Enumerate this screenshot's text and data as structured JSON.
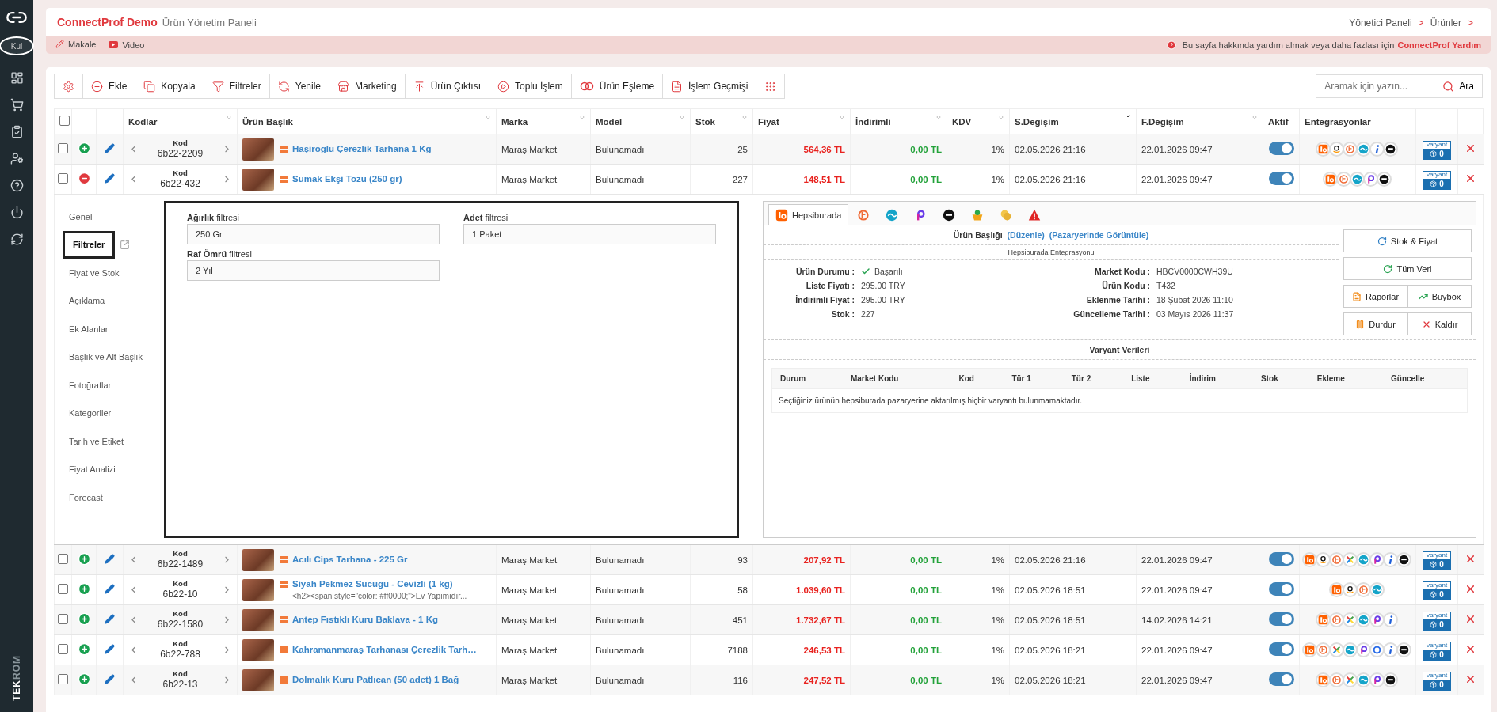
{
  "sidebar": {
    "avatar_text": "Kul",
    "brand": "**TEK**ROM"
  },
  "header": {
    "title": "ConnectProf Demo",
    "subtitle": "Ürün Yönetim Paneli",
    "breadcrumb": [
      {
        "label": "Yönetici Paneli",
        "separator": ">"
      },
      {
        "label": "Ürünler",
        "separator": ">"
      }
    ]
  },
  "help_bar": {
    "links": [
      {
        "kind": "article",
        "label": "Makale"
      },
      {
        "kind": "video",
        "label": "Video"
      }
    ],
    "help_text": "Bu sayfa hakkında yardım almak veya daha fazlası için",
    "help_link": "ConnectProf Yardım"
  },
  "toolbar": {
    "buttons": [
      {
        "kind": "settings"
      },
      {
        "kind": "add",
        "label": "Ekle"
      },
      {
        "kind": "copy",
        "label": "Kopyala"
      },
      {
        "kind": "filter",
        "label": "Filtreler"
      },
      {
        "kind": "refresh",
        "label": "Yenile"
      },
      {
        "kind": "store",
        "label": "Marketing"
      },
      {
        "kind": "export",
        "label": "Ürün Çıktısı"
      },
      {
        "kind": "bulk",
        "label": "Toplu İşlem"
      },
      {
        "kind": "match",
        "label": "Ürün Eşleme"
      },
      {
        "kind": "history",
        "label": "İşlem Geçmişi"
      },
      {
        "kind": "grid"
      }
    ],
    "search": {
      "placeholder": "Aramak için yazın...",
      "button": "Ara"
    }
  },
  "table": {
    "select_all": false,
    "columns": [
      {
        "kind": "check"
      },
      {
        "kind": "blank"
      },
      {
        "kind": "blank"
      },
      {
        "kind": "text",
        "label": "Kodlar",
        "sortable": true,
        "sorted": false
      },
      {
        "kind": "text",
        "label": "Ürün Başlık",
        "sortable": true,
        "sorted": false
      },
      {
        "kind": "text",
        "label": "Marka",
        "sortable": true,
        "sorted": false
      },
      {
        "kind": "text",
        "label": "Model",
        "sortable": true,
        "sorted": false
      },
      {
        "kind": "text",
        "label": "Stok",
        "sortable": true,
        "sorted": false
      },
      {
        "kind": "text",
        "label": "Fiyat",
        "sortable": true,
        "sorted": false
      },
      {
        "kind": "text",
        "label": "İndirimli",
        "sortable": true,
        "sorted": false
      },
      {
        "kind": "text",
        "label": "KDV",
        "sortable": true,
        "sorted": false
      },
      {
        "kind": "text",
        "label": "S.Değişim",
        "sortable": true,
        "sorted": true
      },
      {
        "kind": "text",
        "label": "F.Değişim",
        "sortable": true,
        "sorted": false
      },
      {
        "kind": "text",
        "label": "Aktif"
      },
      {
        "kind": "text",
        "label": "Entegrasyonlar"
      },
      {
        "kind": "blank"
      },
      {
        "kind": "blank"
      }
    ],
    "rows": [
      {
        "checked": false,
        "expanded": false,
        "code_label": "Kod",
        "code": "6b22-2209",
        "title": "Haşiroğlu Çerezlik Tarhana 1 Kg",
        "brand": "Maraş Market",
        "model": "Bulunamadı",
        "stock": "25",
        "price": "564,36 TL",
        "discount_price": "0,00 TL",
        "vat": "1%",
        "s_change": "02.05.2026 21:16",
        "f_change": "22.01.2026 09:47",
        "active": true,
        "integrations": [
          {
            "kind": "hb"
          },
          {
            "kind": "amazon"
          },
          {
            "kind": "t"
          },
          {
            "kind": "wave"
          },
          {
            "kind": "i"
          },
          {
            "kind": "fit"
          }
        ],
        "variant_label": "varyant",
        "variant_count": "0"
      },
      {
        "checked": false,
        "expanded": true,
        "code_label": "Kod",
        "code": "6b22-432",
        "title": "Sumak Ekşi Tozu (250 gr)",
        "brand": "Maraş Market",
        "model": "Bulunamadı",
        "stock": "227",
        "price": "148,51 TL",
        "discount_price": "0,00 TL",
        "vat": "1%",
        "s_change": "02.05.2026 21:16",
        "f_change": "22.01.2026 09:47",
        "active": true,
        "integrations": [
          {
            "kind": "hb"
          },
          {
            "kind": "t"
          },
          {
            "kind": "wave"
          },
          {
            "kind": "p"
          },
          {
            "kind": "fit"
          }
        ],
        "variant_label": "varyant",
        "variant_count": "0",
        "detail": {
          "side_tabs": [
            {
              "label": "Genel",
              "selected": false
            },
            {
              "label": "Filtreler",
              "selected": true
            },
            {
              "label": "Fiyat ve Stok",
              "selected": false
            },
            {
              "label": "Açıklama",
              "selected": false
            },
            {
              "label": "Ek Alanlar",
              "selected": false
            },
            {
              "label": "Başlık ve Alt Başlık",
              "selected": false
            },
            {
              "label": "Fotoğraflar",
              "selected": false
            },
            {
              "label": "Kategoriler",
              "selected": false
            },
            {
              "label": "Tarih ve Etiket",
              "selected": false
            },
            {
              "label": "Fiyat Analizi",
              "selected": false
            },
            {
              "label": "Forecast",
              "selected": false
            }
          ],
          "filters": [
            {
              "label": "**Ağırlık** filtresi",
              "value": "250 Gr"
            },
            {
              "label": "**Adet** filtresi",
              "value": "1 Paket"
            },
            {
              "label": "**Raf Ömrü** filtresi",
              "value": "2 Yıl"
            }
          ],
          "market": {
            "tabs": [
              {
                "kind": "hb",
                "label": "Hepsiburada",
                "selected": true
              },
              {
                "kind": "t",
                "selected": false
              },
              {
                "kind": "wave",
                "selected": false
              },
              {
                "kind": "p",
                "selected": false
              },
              {
                "kind": "fit",
                "selected": false
              },
              {
                "kind": "basket",
                "selected": false
              },
              {
                "kind": "coins",
                "selected": false
              },
              {
                "kind": "warning",
                "selected": false
              }
            ],
            "title_label": "Ürün Başlığı",
            "edit_link": "(Düzenle)",
            "view_link": "(Pazaryerinde Görüntüle)",
            "section": "Hepsiburada Entegrasyonu",
            "left_fields": [
              {
                "kind": "status",
                "label": "Ürün Durumu :",
                "value": "Başarılı"
              },
              {
                "kind": "plain",
                "label": "Liste Fiyatı :",
                "value": "295.00 TRY"
              },
              {
                "kind": "plain",
                "label": "İndirimli Fiyat :",
                "value": "295.00 TRY"
              },
              {
                "kind": "plain",
                "label": "Stok :",
                "value": "227"
              }
            ],
            "right_fields": [
              {
                "label": "Market Kodu :",
                "value": "HBCV0000CWH39U"
              },
              {
                "label": "Ürün Kodu :",
                "value": "T432"
              },
              {
                "label": "Eklenme Tarihi :",
                "value": "18 Şubat 2026 11:10"
              },
              {
                "label": "Güncelleme Tarihi :",
                "value": "03 Mayıs 2026 11:37"
              }
            ],
            "actions": [
              {
                "kind": "sync",
                "label": "Stok & Fiyat",
                "wide": true
              },
              {
                "kind": "reload",
                "label": "Tüm Veri",
                "wide": true
              },
              {
                "kind": "report",
                "label": "Raporlar",
                "wide": false
              },
              {
                "kind": "buybox",
                "label": "Buybox",
                "wide": false
              },
              {
                "kind": "pause",
                "label": "Durdur",
                "wide": false
              },
              {
                "kind": "remove",
                "label": "Kaldır",
                "wide": false
              }
            ],
            "variants": {
              "title": "Varyant Verileri",
              "columns": [
                "Durum",
                "Market Kodu",
                "Kod",
                "Tür 1",
                "Tür 2",
                "Liste",
                "İndirim",
                "Stok",
                "Ekleme",
                "Güncelle"
              ],
              "empty": "Seçtiğiniz ürünün hepsiburada pazaryerine aktarılmış hiçbir varyantı bulunmamaktadır."
            }
          }
        }
      },
      {
        "checked": false,
        "expanded": false,
        "code_label": "Kod",
        "code": "6b22-1489",
        "title": "Acılı Cips Tarhana - 225 Gr",
        "brand": "Maraş Market",
        "model": "Bulunamadı",
        "stock": "93",
        "price": "207,92 TL",
        "discount_price": "0,00 TL",
        "vat": "1%",
        "s_change": "02.05.2026 21:16",
        "f_change": "22.01.2026 09:47",
        "active": true,
        "integrations": [
          {
            "kind": "hb"
          },
          {
            "kind": "amazon"
          },
          {
            "kind": "t"
          },
          {
            "kind": "x"
          },
          {
            "kind": "wave"
          },
          {
            "kind": "p"
          },
          {
            "kind": "i"
          },
          {
            "kind": "fit"
          }
        ],
        "variant_label": "varyant",
        "variant_count": "0"
      },
      {
        "checked": false,
        "expanded": false,
        "code_label": "Kod",
        "code": "6b22-10",
        "title": "Siyah Pekmez Sucuğu - Cevizli (1 kg)",
        "subtitle": "<h2><span style=\"color: #ff0000;\">Ev Yapımıdır...",
        "brand": "Maraş Market",
        "model": "Bulunamadı",
        "stock": "58",
        "price": "1.039,60 TL",
        "discount_price": "0,00 TL",
        "vat": "1%",
        "s_change": "02.05.2026 18:51",
        "f_change": "22.01.2026 09:47",
        "active": true,
        "integrations": [
          {
            "kind": "hb"
          },
          {
            "kind": "amazon"
          },
          {
            "kind": "t"
          },
          {
            "kind": "wave"
          }
        ],
        "variant_label": "varyant",
        "variant_count": "0"
      },
      {
        "checked": false,
        "expanded": false,
        "code_label": "Kod",
        "code": "6b22-1580",
        "title": "Antep Fıstıklı Kuru Baklava - 1 Kg",
        "brand": "Maraş Market",
        "model": "Bulunamadı",
        "stock": "451",
        "price": "1.732,67 TL",
        "discount_price": "0,00 TL",
        "vat": "1%",
        "s_change": "02.05.2026 18:51",
        "f_change": "14.02.2026 14:21",
        "active": true,
        "integrations": [
          {
            "kind": "hb"
          },
          {
            "kind": "t"
          },
          {
            "kind": "x"
          },
          {
            "kind": "wave"
          },
          {
            "kind": "p"
          },
          {
            "kind": "i"
          }
        ],
        "variant_label": "varyant",
        "variant_count": "0"
      },
      {
        "checked": false,
        "expanded": false,
        "code_label": "Kod",
        "code": "6b22-788",
        "title": "Kahramanmaraş Tarhanası Çerezlik Tarh…",
        "brand": "Maraş Market",
        "model": "Bulunamadı",
        "stock": "7188",
        "price": "246,53 TL",
        "discount_price": "0,00 TL",
        "vat": "1%",
        "s_change": "02.05.2026 18:21",
        "f_change": "22.01.2026 09:47",
        "active": true,
        "integrations": [
          {
            "kind": "hb"
          },
          {
            "kind": "t"
          },
          {
            "kind": "x"
          },
          {
            "kind": "wave"
          },
          {
            "kind": "p"
          },
          {
            "kind": "o"
          },
          {
            "kind": "i"
          },
          {
            "kind": "fit"
          }
        ],
        "variant_label": "varyant",
        "variant_count": "0"
      },
      {
        "checked": false,
        "expanded": false,
        "code_label": "Kod",
        "code": "6b22-13",
        "title": "Dolmalık Kuru Patlıcan (50 adet) 1 Bağ",
        "brand": "Maraş Market",
        "model": "Bulunamadı",
        "stock": "116",
        "price": "247,52 TL",
        "discount_price": "0,00 TL",
        "vat": "1%",
        "s_change": "02.05.2026 18:21",
        "f_change": "22.01.2026 09:47",
        "active": true,
        "integrations": [
          {
            "kind": "hb"
          },
          {
            "kind": "t"
          },
          {
            "kind": "x"
          },
          {
            "kind": "wave"
          },
          {
            "kind": "p"
          },
          {
            "kind": "fit"
          }
        ],
        "variant_label": "varyant",
        "variant_count": "0"
      }
    ]
  }
}
